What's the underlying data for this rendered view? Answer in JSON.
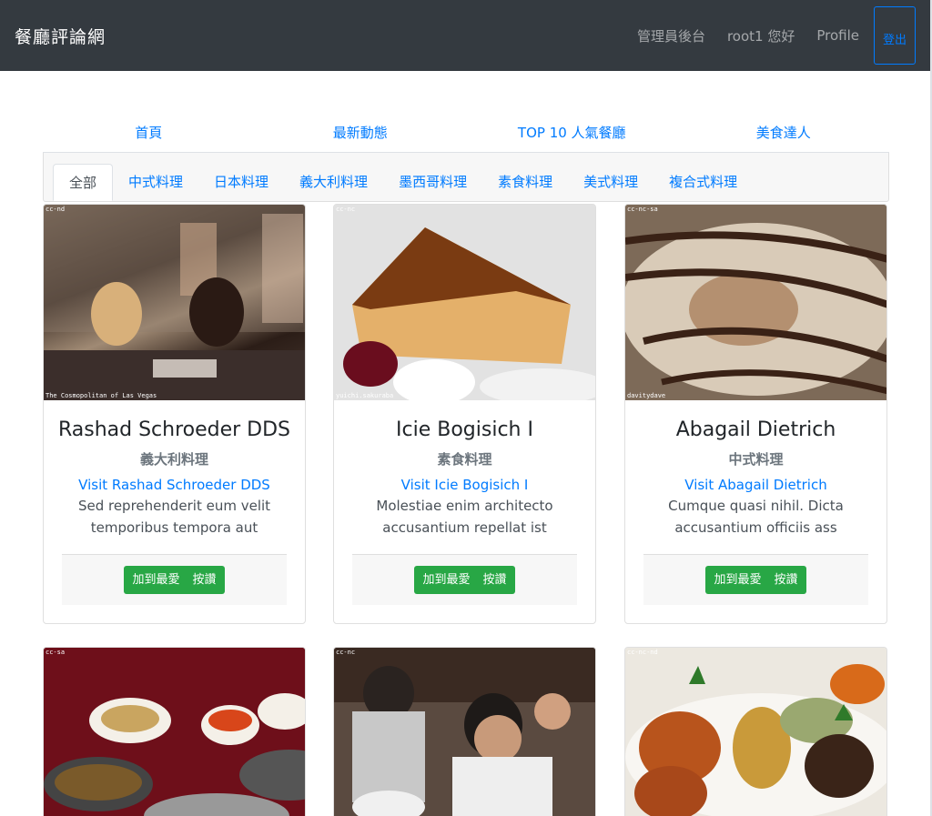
{
  "navbar": {
    "brand": "餐廳評論網",
    "admin": "管理員後台",
    "greeting": "root1 您好",
    "profile": "Profile",
    "logout": "登出"
  },
  "main_nav": [
    "首頁",
    "最新動態",
    "TOP 10 人氣餐廳",
    "美食達人"
  ],
  "categories": [
    "全部",
    "中式料理",
    "日本料理",
    "義大利料理",
    "墨西哥料理",
    "素食料理",
    "美式料理",
    "複合式料理"
  ],
  "restaurants": [
    {
      "name": "Rashad Schroeder DDS",
      "category": "義大利料理",
      "link": "Visit Rashad Schroeder DDS",
      "desc": "Sed reprehenderit eum velit temporibus tempora aut",
      "license": "cc-nd",
      "caption": "The Cosmopolitan of Las Vegas"
    },
    {
      "name": "Icie Bogisich I",
      "category": "素食料理",
      "link": "Visit Icie Bogisich I",
      "desc": "Molestiae enim architecto accusantium repellat ist",
      "license": "cc-nc",
      "caption": "yuichi.sakuraba"
    },
    {
      "name": "Abagail Dietrich",
      "category": "中式料理",
      "link": "Visit Abagail Dietrich",
      "desc": "Cumque quasi nihil. Dicta accusantium officiis ass",
      "license": "cc-nc-sa",
      "caption": "davitydave"
    }
  ],
  "second_row": [
    {
      "license": "cc-sa"
    },
    {
      "license": "cc-nc"
    },
    {
      "license": "cc-nc-nd"
    }
  ],
  "buttons": {
    "favorite": "加到最愛",
    "like": "按讚"
  },
  "colors": {
    "navbar": "#343a40",
    "link": "#007bff",
    "button": "#28a745"
  }
}
